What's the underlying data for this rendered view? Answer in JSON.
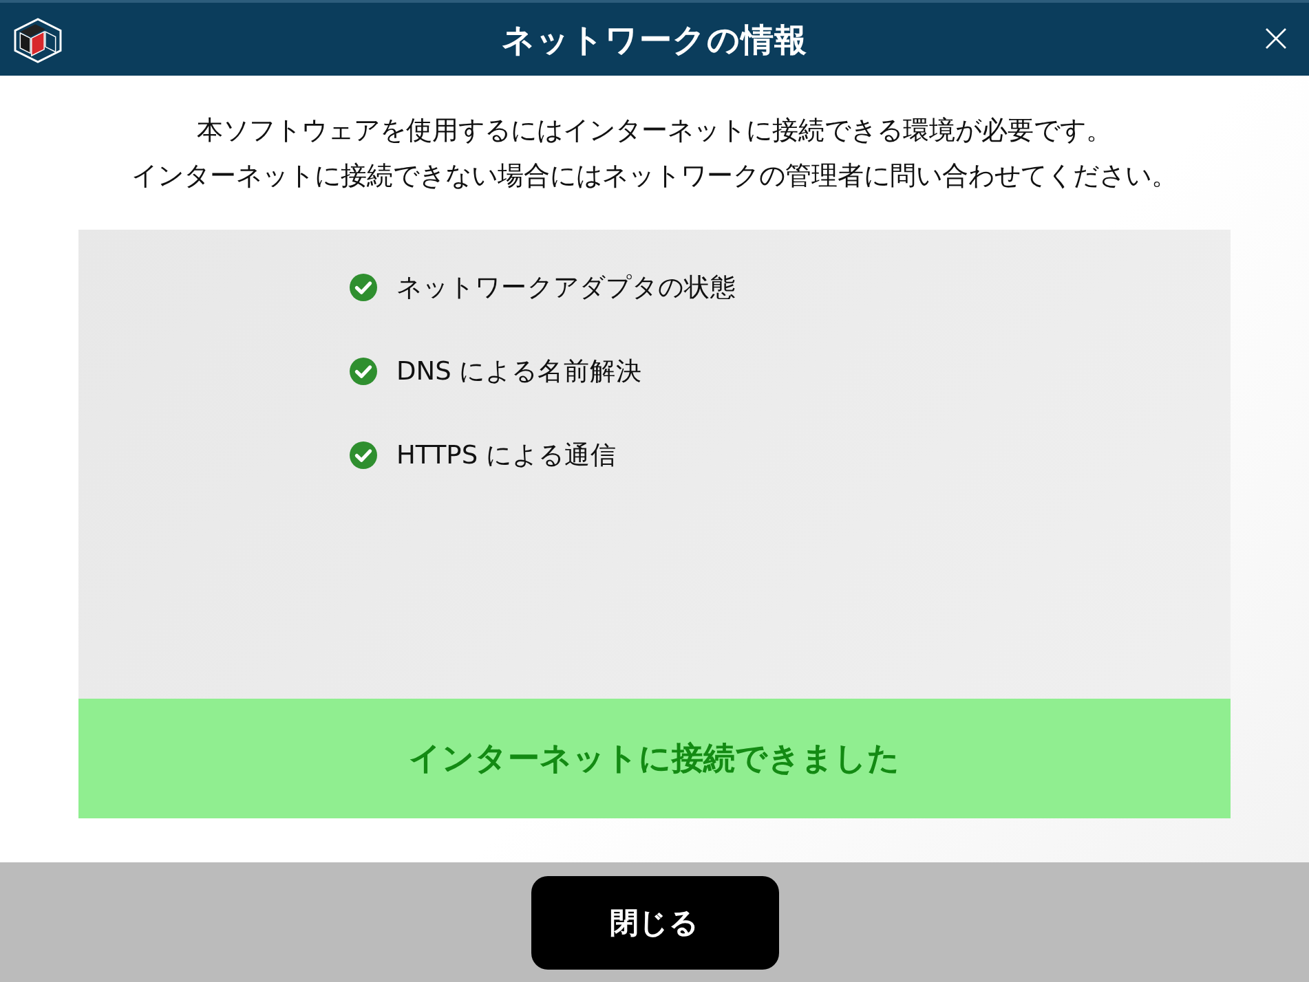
{
  "window": {
    "title": "ネットワークの情報"
  },
  "description": [
    "本ソフトウェアを使用するにはインターネットに接続できる環境が必要です。",
    "インターネットに接続できない場合にはネットワークの管理者に問い合わせてください。"
  ],
  "checks": [
    {
      "label": "ネットワークアダプタの状態",
      "passed": true
    },
    {
      "label": "DNS による名前解決",
      "passed": true
    },
    {
      "label": "HTTPS による通信",
      "passed": true
    }
  ],
  "result": {
    "kind": "success",
    "text": "インターネットに接続できました"
  },
  "buttons": [
    "閉じる"
  ]
}
